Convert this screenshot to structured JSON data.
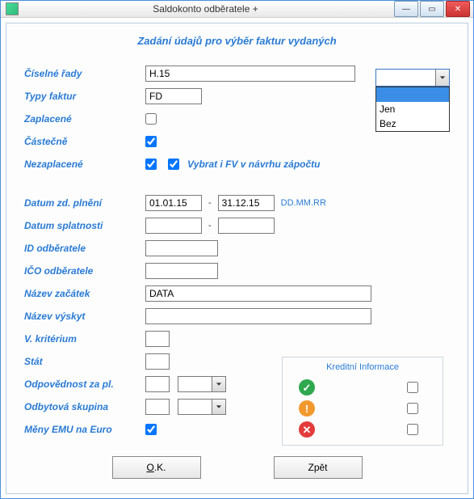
{
  "window": {
    "title": "Saldokonto odběratele +"
  },
  "subtitle": "Zadání údajů pro výběr faktur vydaných",
  "labels": {
    "ciselne_rady": "Číselné řady",
    "typy_faktur": "Typy faktur",
    "zaplacene": "Zaplacené",
    "castecne": "Částečně",
    "nezaplacene": "Nezaplacené",
    "vybrat_fv": "Vybrat i FV v návrhu zápočtu",
    "datum_zd": "Datum zd. plnění",
    "datum_spl": "Datum splatnosti",
    "id_od": "ID odběratele",
    "ico_od": "IČO odběratele",
    "nazev_zac": "Název začátek",
    "nazev_vys": "Název výskyt",
    "v_krit": "V. kritérium",
    "stat": "Stát",
    "odpovednost": "Odpovědnost za pl.",
    "odbytova": "Odbytová skupina",
    "meny_emu": "Měny EMU na Euro",
    "date_hint": "DD.MM.RR",
    "kreditni": "Kreditní Informace"
  },
  "values": {
    "ciselne_rady": "H.15",
    "typy_faktur": "FD",
    "datum_zd_from": "01.01.15",
    "datum_zd_to": "31.12.15",
    "datum_spl_from": "",
    "datum_spl_to": "",
    "id_od": "",
    "ico_od": "",
    "nazev_zac": "DATA",
    "nazev_vys": "",
    "v_krit": "",
    "stat": "",
    "odpovednost_txt": "",
    "odpovednost_sel": "",
    "odbytova_txt": "",
    "odbytova_sel": ""
  },
  "checks": {
    "zaplacene": false,
    "castecne": true,
    "nezaplacene": true,
    "vybrat_fv": true,
    "meny_emu": true,
    "kredit_ok": false,
    "kredit_warn": false,
    "kredit_bad": false
  },
  "dropdown": {
    "selected": "",
    "options": [
      "",
      "Jen",
      "Bez"
    ]
  },
  "buttons": {
    "ok": "O.K.",
    "back": "Zpět"
  }
}
